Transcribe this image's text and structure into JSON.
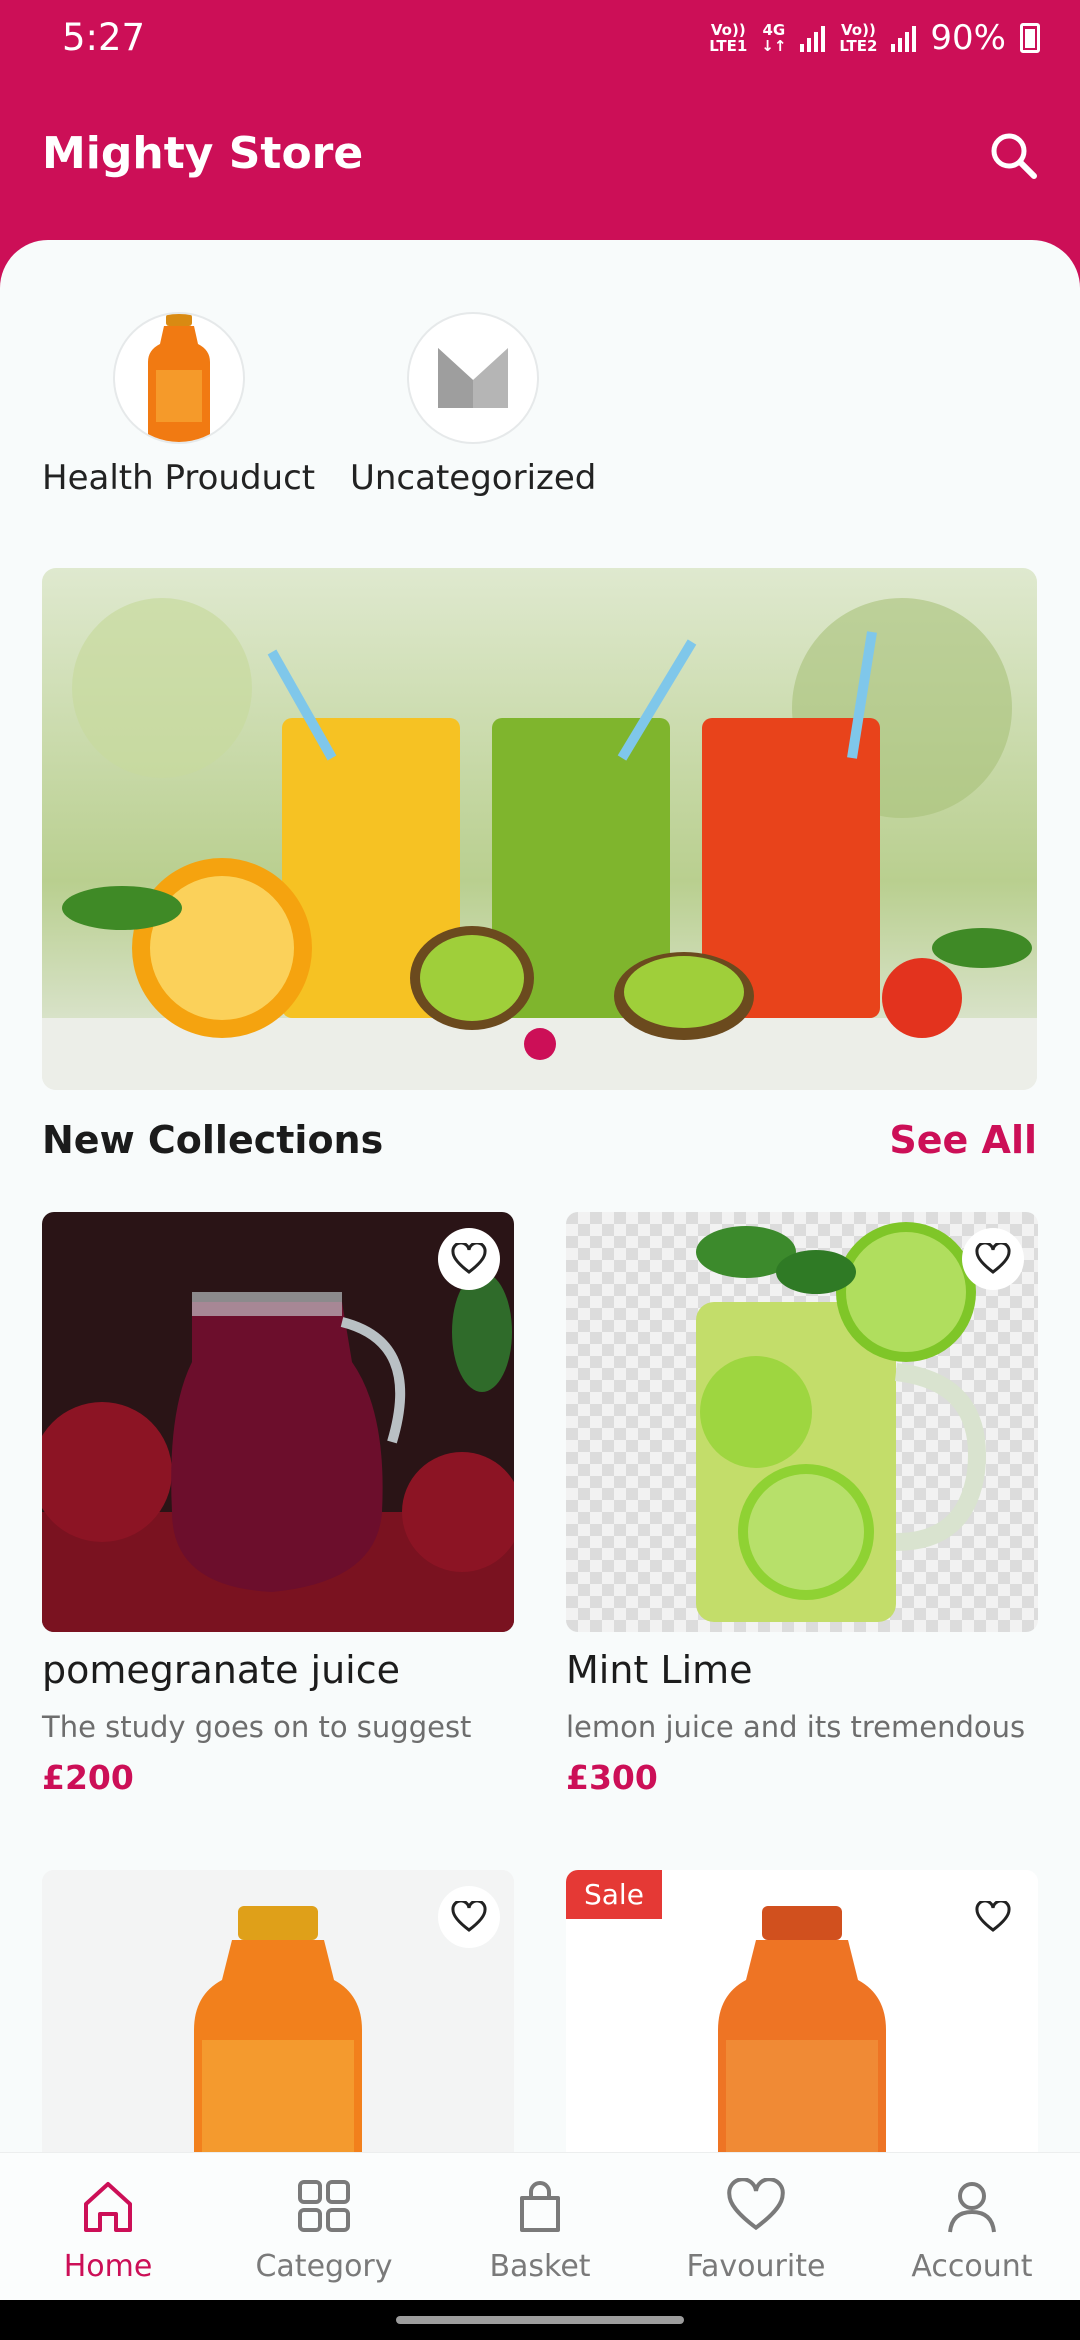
{
  "status_bar": {
    "time": "5:27",
    "sim1": {
      "line1": "Vo))",
      "line2": "LTE1"
    },
    "network": {
      "line1": "4G",
      "line2": "↓↑"
    },
    "sim2": {
      "line1": "Vo))",
      "line2": "LTE2"
    },
    "battery": "90%"
  },
  "app_bar": {
    "title": "Mighty Store",
    "search_icon": "search-icon"
  },
  "categories": [
    {
      "label": "Health Prouduct",
      "icon": "orange-juice-bottle"
    },
    {
      "label": "Uncategorized",
      "icon": "placeholder-logo"
    }
  ],
  "banner": {
    "slides": 1,
    "active_index": 0
  },
  "section": {
    "title": "New Collections",
    "see_all": "See All"
  },
  "products": [
    {
      "name": "pomegranate juice",
      "description": "The study goes on to suggest",
      "price": "£200",
      "sale": false
    },
    {
      "name": "Mint Lime",
      "description": "lemon juice and its tremendous",
      "price": "£300",
      "sale": false
    },
    {
      "name": "",
      "description": "",
      "price": "",
      "sale": false
    },
    {
      "name": "",
      "description": "",
      "price": "",
      "sale": true,
      "badge": "Sale"
    }
  ],
  "bottom_nav": [
    {
      "label": "Home",
      "icon": "home-icon",
      "active": true
    },
    {
      "label": "Category",
      "icon": "grid-icon",
      "active": false
    },
    {
      "label": "Basket",
      "icon": "bag-icon",
      "active": false
    },
    {
      "label": "Favourite",
      "icon": "heart-icon",
      "active": false
    },
    {
      "label": "Account",
      "icon": "user-icon",
      "active": false
    }
  ],
  "colors": {
    "primary": "#cc0f57",
    "background": "#f8fbfb",
    "sale": "#e53935"
  }
}
